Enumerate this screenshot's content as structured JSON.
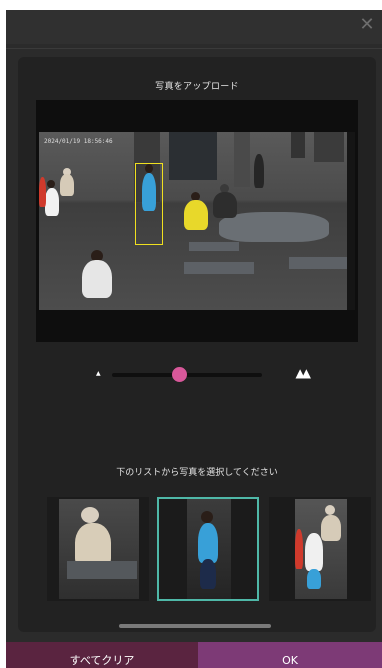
{
  "dialog": {
    "close_icon": "close-icon",
    "title": "写真をアップロード"
  },
  "preview": {
    "timestamp": "2024/01/19 18:56:46"
  },
  "zoom": {
    "small_icon": "mountain-small-icon",
    "large_icon": "mountain-large-icon",
    "level": 0.45
  },
  "selection": {
    "instruction": "下のリストから写真を選択してください",
    "thumbnails": [
      {
        "name": "thumbnail-1",
        "selected": false
      },
      {
        "name": "thumbnail-2",
        "selected": true
      },
      {
        "name": "thumbnail-3",
        "selected": false
      }
    ]
  },
  "footer": {
    "clear_label": "すべてクリア",
    "ok_label": "OK"
  },
  "colors": {
    "accent_pink": "#d8589a",
    "selected_border": "#4fb8a8",
    "detection_box": "#f0e020",
    "clear_button": "#5a2440",
    "ok_button": "#7d3a76"
  }
}
